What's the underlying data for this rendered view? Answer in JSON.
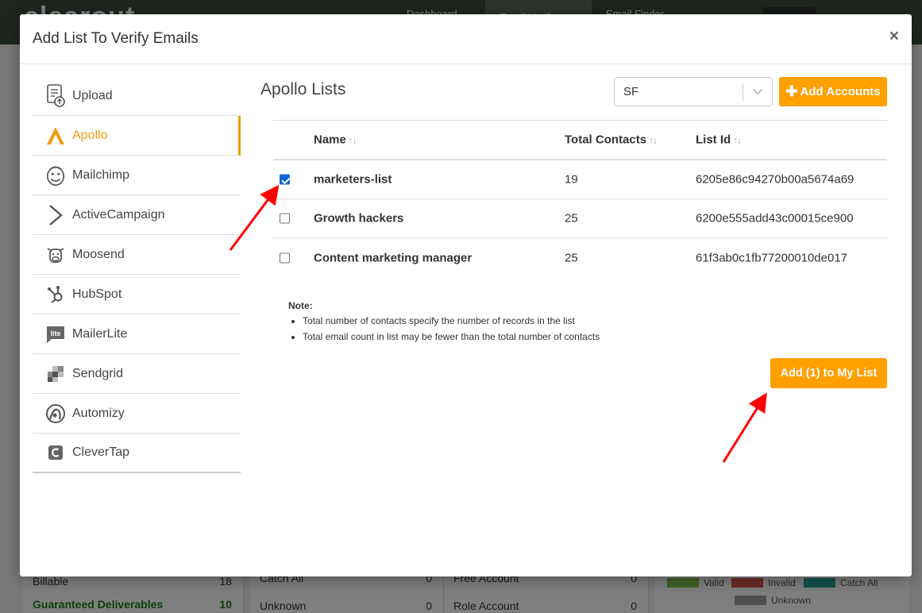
{
  "background": {
    "logo": "clearout",
    "nav": [
      "Dashboard",
      "Email Verifier",
      "Email Finder",
      ""
    ],
    "stats": [
      {
        "rows": [
          {
            "label": "Billable",
            "value": "18"
          },
          {
            "label": "Guaranteed Deliverables",
            "value": "10"
          }
        ]
      },
      {
        "rows": [
          {
            "label": "Catch All",
            "value": "0"
          },
          {
            "label": "Unknown",
            "value": "0"
          }
        ]
      },
      {
        "rows": [
          {
            "label": "Free Account",
            "value": "0"
          },
          {
            "label": "Role Account",
            "value": "0"
          }
        ]
      }
    ],
    "legend": [
      {
        "label": "Valid",
        "color": "#8bc34a"
      },
      {
        "label": "Invalid",
        "color": "#d9534f"
      },
      {
        "label": "Catch All",
        "color": "#26a69a"
      },
      {
        "label": "Unknown",
        "color": "#9e9e9e"
      }
    ]
  },
  "modal": {
    "title": "Add List To Verify Emails",
    "close_label": "×"
  },
  "sidebar": {
    "items": [
      {
        "label": "Upload",
        "icon": "upload-icon"
      },
      {
        "label": "Apollo",
        "icon": "apollo-icon"
      },
      {
        "label": "Mailchimp",
        "icon": "mailchimp-icon"
      },
      {
        "label": "ActiveCampaign",
        "icon": "activecampaign-icon"
      },
      {
        "label": "Moosend",
        "icon": "moosend-icon"
      },
      {
        "label": "HubSpot",
        "icon": "hubspot-icon"
      },
      {
        "label": "MailerLite",
        "icon": "mailerlite-icon"
      },
      {
        "label": "Sendgrid",
        "icon": "sendgrid-icon"
      },
      {
        "label": "Automizy",
        "icon": "automizy-icon"
      },
      {
        "label": "CleverTap",
        "icon": "clevertap-icon"
      }
    ],
    "active": "Apollo"
  },
  "main": {
    "title": "Apollo Lists",
    "account_select": {
      "value": "SF"
    },
    "add_accounts_label": "Add Accounts",
    "table": {
      "columns": [
        "Name",
        "Total Contacts",
        "List Id"
      ],
      "rows": [
        {
          "checked": true,
          "name": "marketers-list",
          "total": "19",
          "list_id": "6205e86c94270b00a5674a69"
        },
        {
          "checked": false,
          "name": "Growth hackers",
          "total": "25",
          "list_id": "6200e555add43c00015ce900"
        },
        {
          "checked": false,
          "name": "Content marketing manager",
          "total": "25",
          "list_id": "61f3ab0c1fb77200010de017"
        }
      ]
    },
    "note": {
      "title": "Note:",
      "items": [
        "Total number of contacts specify the number of records in the list",
        "Total email count in list may be fewer than the total number of contacts"
      ]
    },
    "add_to_list_label": "Add (1) to My List"
  },
  "colors": {
    "accent": "#ff9f00",
    "checkbox": "#0a66d6",
    "annotation_arrow": "#ff0000"
  }
}
